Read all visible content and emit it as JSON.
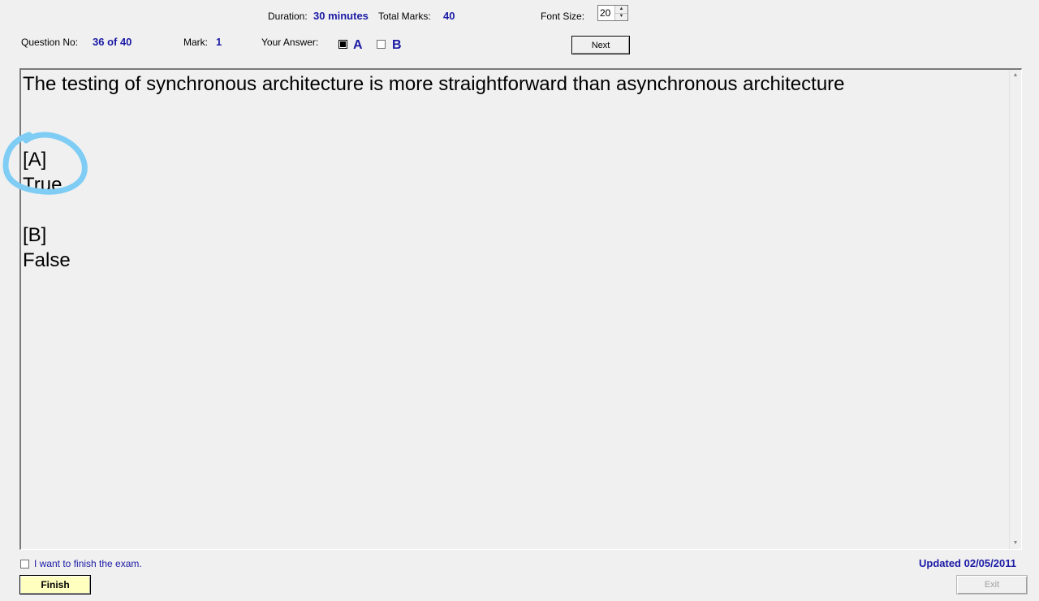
{
  "header": {
    "duration_label": "Duration:",
    "duration_value": "30 minutes",
    "total_marks_label": "Total Marks:",
    "total_marks_value": "40",
    "font_size_label": "Font Size:",
    "font_size_value": "20",
    "question_no_label": "Question No:",
    "question_no_value": "36 of 40",
    "mark_label": "Mark:",
    "mark_value": "1",
    "your_answer_label": "Your Answer:",
    "answer_a_label": "A",
    "answer_a_checked": true,
    "answer_b_label": "B",
    "answer_b_checked": false,
    "next_label": "Next"
  },
  "question": {
    "text": "The testing of synchronous architecture is more straightforward than asynchronous architecture",
    "options": [
      {
        "key": "[A]",
        "text": "True"
      },
      {
        "key": "[B]",
        "text": "False"
      }
    ]
  },
  "footer": {
    "finish_checkbox_label": "I want to finish the exam.",
    "finish_label": "Finish",
    "updated_text": "Updated 02/05/2011",
    "exit_label": "Exit"
  },
  "colors": {
    "value_blue": "#1a1aa6",
    "finish_bg": "#ffffc0",
    "annotation": "#7fcdf5"
  }
}
